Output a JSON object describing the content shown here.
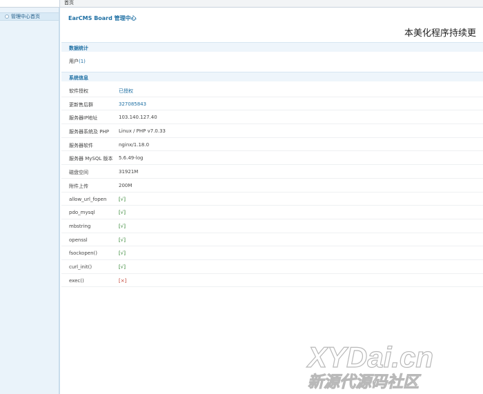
{
  "topbar": {
    "breadcrumb": "首页"
  },
  "sidebar": {
    "items": [
      {
        "label": "管理中心首页"
      }
    ]
  },
  "main": {
    "title": "EarCMS Board 管理中心",
    "marquee": "本美化程序持续更",
    "sections": {
      "stats": {
        "title": "数据统计",
        "users_label": "用户",
        "users_count": "(1)"
      },
      "system": {
        "title": "系统信息"
      }
    },
    "system_rows": [
      {
        "key": "软件授权",
        "value": "已授权",
        "status": "link"
      },
      {
        "key": "更新售后群",
        "value": "327085843",
        "status": "link"
      },
      {
        "key": "服务器IP地址",
        "value": "103.140.127.40",
        "status": "normal"
      },
      {
        "key": "服务器系统及 PHP",
        "value": "Linux / PHP v7.0.33",
        "status": "normal"
      },
      {
        "key": "服务器软件",
        "value": "nginx/1.18.0",
        "status": "normal"
      },
      {
        "key": "服务器 MySQL 版本",
        "value": "5.6.49-log",
        "status": "normal"
      },
      {
        "key": "磁盘空间",
        "value": "31921M",
        "status": "normal"
      },
      {
        "key": "附件上传",
        "value": "200M",
        "status": "normal"
      },
      {
        "key": "allow_url_fopen",
        "value": "[√]",
        "status": "ok"
      },
      {
        "key": "pdo_mysql",
        "value": "[√]",
        "status": "ok"
      },
      {
        "key": "mbstring",
        "value": "[√]",
        "status": "ok"
      },
      {
        "key": "openssl",
        "value": "[√]",
        "status": "ok"
      },
      {
        "key": "fsockopen()",
        "value": "[√]",
        "status": "ok"
      },
      {
        "key": "curl_init()",
        "value": "[√]",
        "status": "ok"
      },
      {
        "key": "exec()",
        "value": "[×]",
        "status": "bad"
      }
    ]
  },
  "watermark": {
    "line1": "XYDai.cn",
    "line2": "新源代源码社区"
  },
  "colors": {
    "accent": "#1e6fa3",
    "ok": "#1f7a1f",
    "bad": "#c0392b",
    "sidebar": "#eaf3fa"
  }
}
